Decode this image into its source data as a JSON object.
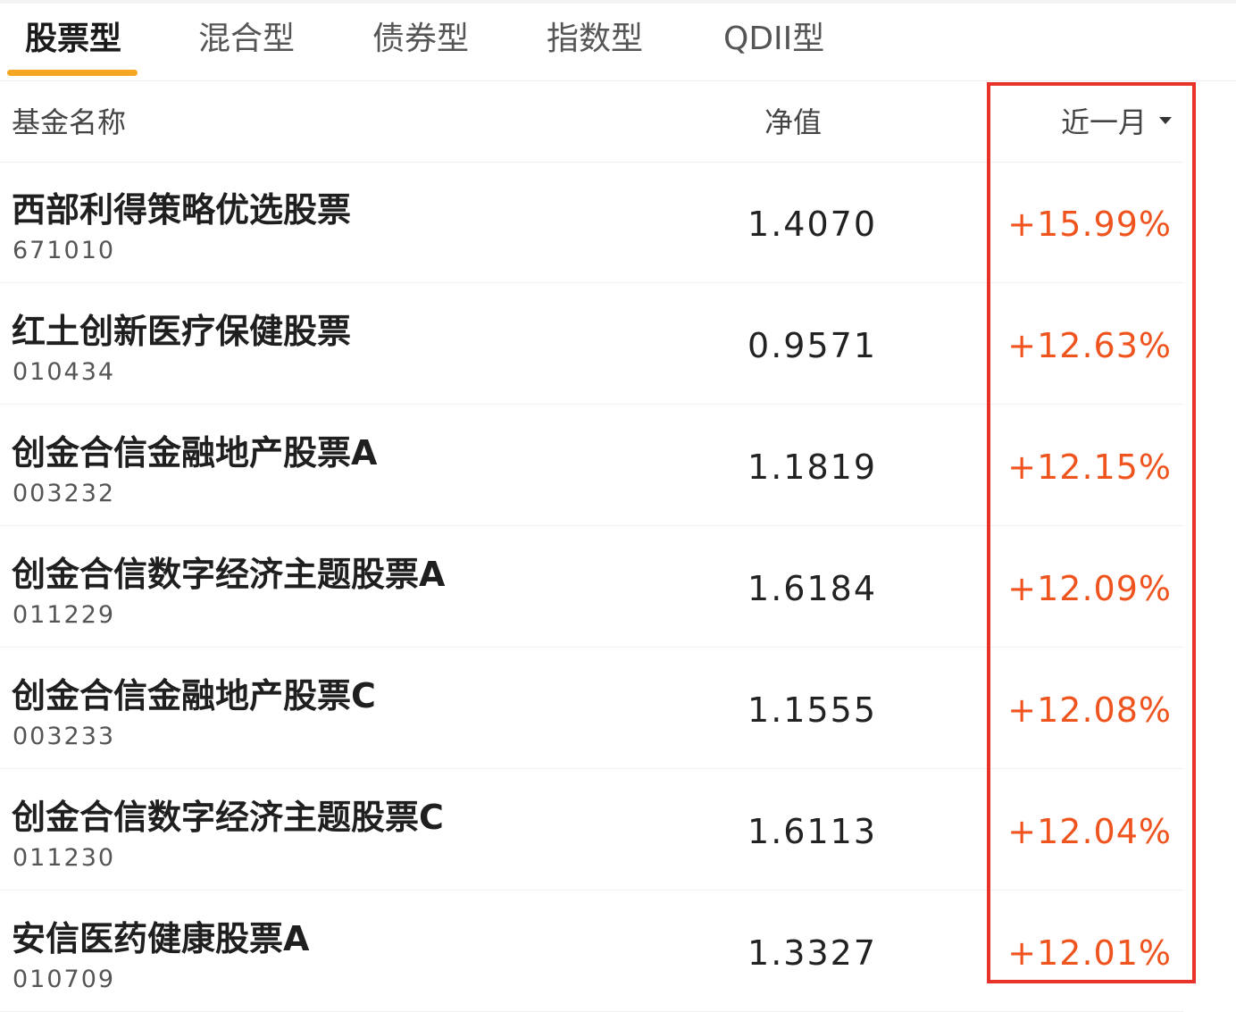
{
  "tabs": [
    {
      "label": "股票型",
      "active": true
    },
    {
      "label": "混合型",
      "active": false
    },
    {
      "label": "债券型",
      "active": false
    },
    {
      "label": "指数型",
      "active": false
    },
    {
      "label": "QDII型",
      "active": false
    }
  ],
  "header": {
    "name_col": "基金名称",
    "nav_col": "净值",
    "period_col": "近一月"
  },
  "colors": {
    "accent": "#f5a623",
    "gain": "#f0541e",
    "highlight": "#e8332a"
  },
  "funds": [
    {
      "name": "西部利得策略优选股票",
      "code": "671010",
      "nav": "1.4070",
      "change": "+15.99%"
    },
    {
      "name": "红土创新医疗保健股票",
      "code": "010434",
      "nav": "0.9571",
      "change": "+12.63%"
    },
    {
      "name": "创金合信金融地产股票A",
      "code": "003232",
      "nav": "1.1819",
      "change": "+12.15%"
    },
    {
      "name": "创金合信数字经济主题股票A",
      "code": "011229",
      "nav": "1.6184",
      "change": "+12.09%"
    },
    {
      "name": "创金合信金融地产股票C",
      "code": "003233",
      "nav": "1.1555",
      "change": "+12.08%"
    },
    {
      "name": "创金合信数字经济主题股票C",
      "code": "011230",
      "nav": "1.6113",
      "change": "+12.04%"
    },
    {
      "name": "安信医药健康股票A",
      "code": "010709",
      "nav": "1.3327",
      "change": "+12.01%"
    }
  ]
}
